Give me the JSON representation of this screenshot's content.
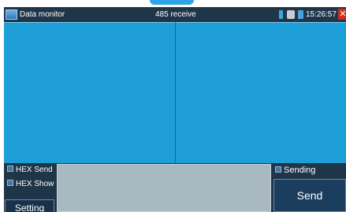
{
  "titlebar": {
    "title": "Data monitor",
    "mode": "485 receive",
    "time": "15:26:57",
    "close_symbol": "✕"
  },
  "status_icons": [
    "signal-icon",
    "network-icon",
    "battery-icon"
  ],
  "controls": {
    "hex_send_label": "HEX Send",
    "hex_show_label": "HEX Show",
    "sending_label": "Sending",
    "setting_label": "Setting",
    "send_label": "Send"
  },
  "colors": {
    "display_background": "#1e9ed6",
    "panel_background": "#1f3548",
    "input_background": "#a9b9c2",
    "close_button": "#d22a1f"
  }
}
